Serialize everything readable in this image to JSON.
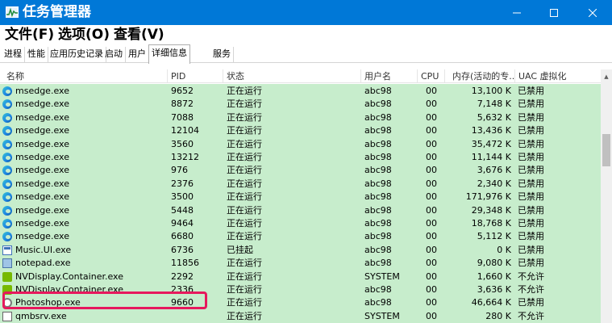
{
  "window": {
    "title": "任务管理器",
    "accent_color": "#0078d7",
    "controls": [
      "minimize-icon",
      "maximize-icon",
      "close-icon"
    ]
  },
  "menu": {
    "file": "文件(F)",
    "options": "选项(O)",
    "view": "查看(V)"
  },
  "tabs": [
    {
      "label": "进程"
    },
    {
      "label": "性能"
    },
    {
      "label": "应用历史记录"
    },
    {
      "label": "启动"
    },
    {
      "label": "用户"
    },
    {
      "label": "详细信息",
      "active": true
    },
    {
      "label": "服务"
    }
  ],
  "table": {
    "columns": [
      "名称",
      "PID",
      "状态",
      "用户名",
      "CPU",
      "内存(活动的专...",
      "UAC 虚拟化"
    ],
    "row_background": "#c7edcc",
    "highlight_color": "#e6195d",
    "rows": [
      {
        "icon": "edge-icon",
        "name": "msedge.exe",
        "pid": "9652",
        "status": "正在运行",
        "user": "abc98",
        "cpu": "00",
        "mem": "13,100 K",
        "uac": "已禁用"
      },
      {
        "icon": "edge-icon",
        "name": "msedge.exe",
        "pid": "8872",
        "status": "正在运行",
        "user": "abc98",
        "cpu": "00",
        "mem": "7,148 K",
        "uac": "已禁用"
      },
      {
        "icon": "edge-icon",
        "name": "msedge.exe",
        "pid": "7088",
        "status": "正在运行",
        "user": "abc98",
        "cpu": "00",
        "mem": "5,632 K",
        "uac": "已禁用"
      },
      {
        "icon": "edge-icon",
        "name": "msedge.exe",
        "pid": "12104",
        "status": "正在运行",
        "user": "abc98",
        "cpu": "00",
        "mem": "13,436 K",
        "uac": "已禁用"
      },
      {
        "icon": "edge-icon",
        "name": "msedge.exe",
        "pid": "3560",
        "status": "正在运行",
        "user": "abc98",
        "cpu": "00",
        "mem": "35,472 K",
        "uac": "已禁用"
      },
      {
        "icon": "edge-icon",
        "name": "msedge.exe",
        "pid": "13212",
        "status": "正在运行",
        "user": "abc98",
        "cpu": "00",
        "mem": "11,144 K",
        "uac": "已禁用"
      },
      {
        "icon": "edge-icon",
        "name": "msedge.exe",
        "pid": "976",
        "status": "正在运行",
        "user": "abc98",
        "cpu": "00",
        "mem": "3,676 K",
        "uac": "已禁用"
      },
      {
        "icon": "edge-icon",
        "name": "msedge.exe",
        "pid": "2376",
        "status": "正在运行",
        "user": "abc98",
        "cpu": "00",
        "mem": "2,340 K",
        "uac": "已禁用"
      },
      {
        "icon": "edge-icon",
        "name": "msedge.exe",
        "pid": "3500",
        "status": "正在运行",
        "user": "abc98",
        "cpu": "00",
        "mem": "171,976 K",
        "uac": "已禁用"
      },
      {
        "icon": "edge-icon",
        "name": "msedge.exe",
        "pid": "5448",
        "status": "正在运行",
        "user": "abc98",
        "cpu": "00",
        "mem": "29,348 K",
        "uac": "已禁用"
      },
      {
        "icon": "edge-icon",
        "name": "msedge.exe",
        "pid": "9464",
        "status": "正在运行",
        "user": "abc98",
        "cpu": "00",
        "mem": "18,768 K",
        "uac": "已禁用"
      },
      {
        "icon": "edge-icon",
        "name": "msedge.exe",
        "pid": "6680",
        "status": "正在运行",
        "user": "abc98",
        "cpu": "00",
        "mem": "5,112 K",
        "uac": "已禁用"
      },
      {
        "icon": "app-window-icon",
        "name": "Music.UI.exe",
        "pid": "6736",
        "status": "已挂起",
        "user": "abc98",
        "cpu": "00",
        "mem": "0 K",
        "uac": "已禁用"
      },
      {
        "icon": "notepad-icon",
        "name": "notepad.exe",
        "pid": "11856",
        "status": "正在运行",
        "user": "abc98",
        "cpu": "00",
        "mem": "9,080 K",
        "uac": "已禁用"
      },
      {
        "icon": "nvidia-icon",
        "name": "NVDisplay.Container.exe",
        "pid": "2292",
        "status": "正在运行",
        "user": "SYSTEM",
        "cpu": "00",
        "mem": "1,660 K",
        "uac": "不允许"
      },
      {
        "icon": "nvidia-icon",
        "name": "NVDisplay.Container.exe",
        "pid": "2336",
        "status": "正在运行",
        "user": "abc98",
        "cpu": "00",
        "mem": "3,636 K",
        "uac": "不允许"
      },
      {
        "icon": "photoshop-icon",
        "name": "Photoshop.exe",
        "pid": "9660",
        "status": "正在运行",
        "user": "abc98",
        "cpu": "00",
        "mem": "46,664 K",
        "uac": "已禁用"
      },
      {
        "icon": "generic-app-icon",
        "name": "qmbsrv.exe",
        "pid": "",
        "status": "正在运行",
        "user": "SYSTEM",
        "cpu": "00",
        "mem": "280 K",
        "uac": "不允许"
      }
    ]
  }
}
